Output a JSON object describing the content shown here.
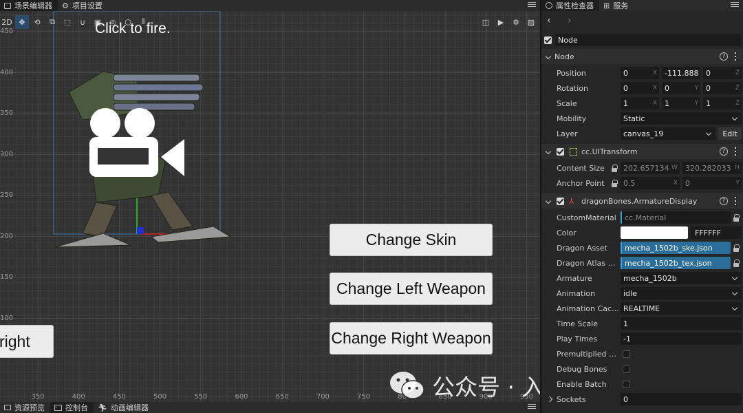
{
  "scene_panel": {
    "tabs": [
      {
        "label": "场景编辑器",
        "icon": "scene-icon"
      },
      {
        "label": "项目设置",
        "icon": "gear-icon"
      }
    ],
    "toolbar": {
      "mode_label": "2D"
    },
    "title_text": "Click to fire.",
    "y_ticks": [
      "450",
      "400",
      "350",
      "300",
      "250",
      "200",
      "150",
      "100"
    ],
    "x_ticks": [
      "350",
      "400",
      "450",
      "500",
      "550",
      "600",
      "650",
      "700",
      "750",
      "800",
      "850",
      "900",
      "950"
    ],
    "buttons": {
      "change_skin": "Change Skin",
      "change_left": "Change Left Weapon",
      "change_right": "Change Right Weapon",
      "partial_right": "right"
    }
  },
  "bottom_tabs": [
    {
      "label": "资源预览",
      "icon": "folder-icon"
    },
    {
      "label": "控制台",
      "icon": "console-icon"
    },
    {
      "label": "动画编辑器",
      "icon": "animation-icon"
    }
  ],
  "inspector": {
    "tabs": [
      {
        "label": "属性检查器",
        "icon": "inspector-icon"
      },
      {
        "label": "服务",
        "icon": "grid-icon"
      }
    ],
    "node_name": "Node",
    "node_section": {
      "title": "Node",
      "position": {
        "label": "Position",
        "x": "0",
        "y": "-111.888",
        "z": "0"
      },
      "rotation": {
        "label": "Rotation",
        "x": "0",
        "y": "0",
        "z": "0"
      },
      "scale": {
        "label": "Scale",
        "x": "1",
        "y": "1",
        "z": "1"
      },
      "mobility": {
        "label": "Mobility",
        "value": "Static"
      },
      "layer": {
        "label": "Layer",
        "value": "canvas_19",
        "edit": "Edit"
      }
    },
    "uitransform": {
      "title": "cc.UITransform",
      "content_size": {
        "label": "Content Size",
        "w": "202.657134",
        "h": "320.282033"
      },
      "anchor_point": {
        "label": "Anchor Point",
        "x": "0.5",
        "y": "0"
      }
    },
    "armature": {
      "title": "dragonBones.ArmatureDisplay",
      "custom_material": {
        "label": "CustomMaterial",
        "value": "cc.Material"
      },
      "color": {
        "label": "Color",
        "hex": "FFFFFF",
        "swatch": "#ffffff"
      },
      "dragon_asset": {
        "label": "Dragon Asset",
        "value": "mecha_1502b_ske.json"
      },
      "dragon_atlas": {
        "label": "Dragon Atlas A...",
        "value": "mecha_1502b_tex.json"
      },
      "armature": {
        "label": "Armature",
        "value": "mecha_1502b"
      },
      "animation": {
        "label": "Animation",
        "value": "idle"
      },
      "animation_cache": {
        "label": "Animation Cac...",
        "value": "REALTIME"
      },
      "time_scale": {
        "label": "Time Scale",
        "value": "1"
      },
      "play_times": {
        "label": "Play Times",
        "value": "-1"
      },
      "premultiplied": {
        "label": "Premultiplied Al..."
      },
      "debug_bones": {
        "label": "Debug Bones"
      },
      "enable_batch": {
        "label": "Enable Batch"
      },
      "sockets": {
        "label": "Sockets",
        "value": "0"
      }
    },
    "axis_labels": {
      "x": "X",
      "y": "Y",
      "z": "Z",
      "w": "W",
      "h": "H"
    }
  },
  "watermark": {
    "text": "公众号 · 入门游戏开发"
  }
}
